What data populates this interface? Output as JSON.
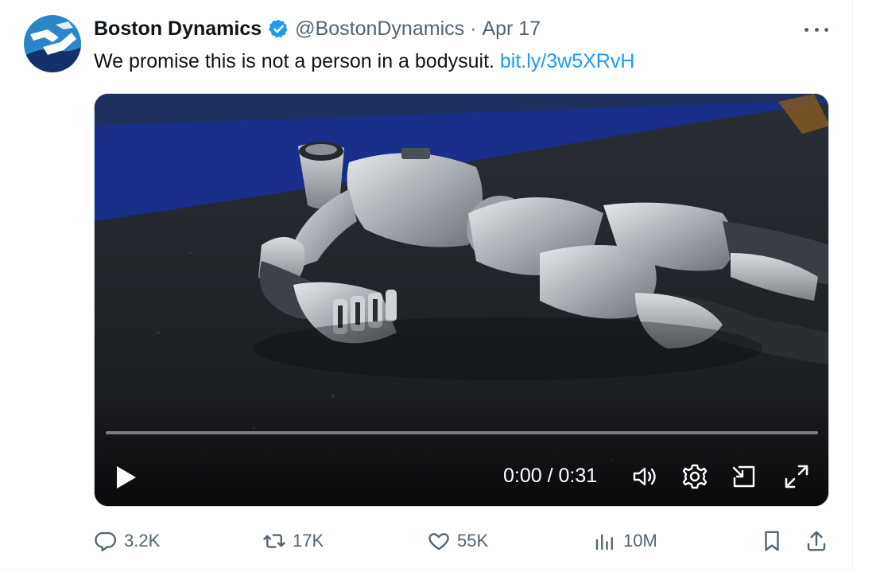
{
  "tweet": {
    "author_name": "Boston Dynamics",
    "handle": "@BostonDynamics",
    "separator": "·",
    "date": "Apr 17",
    "text": "We promise this is not a person in a bodysuit. ",
    "link_text": "bit.ly/3w5XRvH"
  },
  "video": {
    "time_display": "0:00 / 0:31",
    "progress": 0.0
  },
  "actions": {
    "replies": "3.2K",
    "reposts": "17K",
    "likes": "55K",
    "views": "10M"
  },
  "colors": {
    "accent": "#1d9bf0",
    "secondary_text": "#536471",
    "primary_text": "#0f1419",
    "verified": "#1d9bf0"
  },
  "icons": [
    "avatar-logo",
    "verified-badge-icon",
    "more-icon",
    "play-icon",
    "volume-icon",
    "gear-icon",
    "pip-icon",
    "fullscreen-icon",
    "reply-icon",
    "repost-icon",
    "like-icon",
    "views-icon",
    "bookmark-icon",
    "share-icon"
  ]
}
